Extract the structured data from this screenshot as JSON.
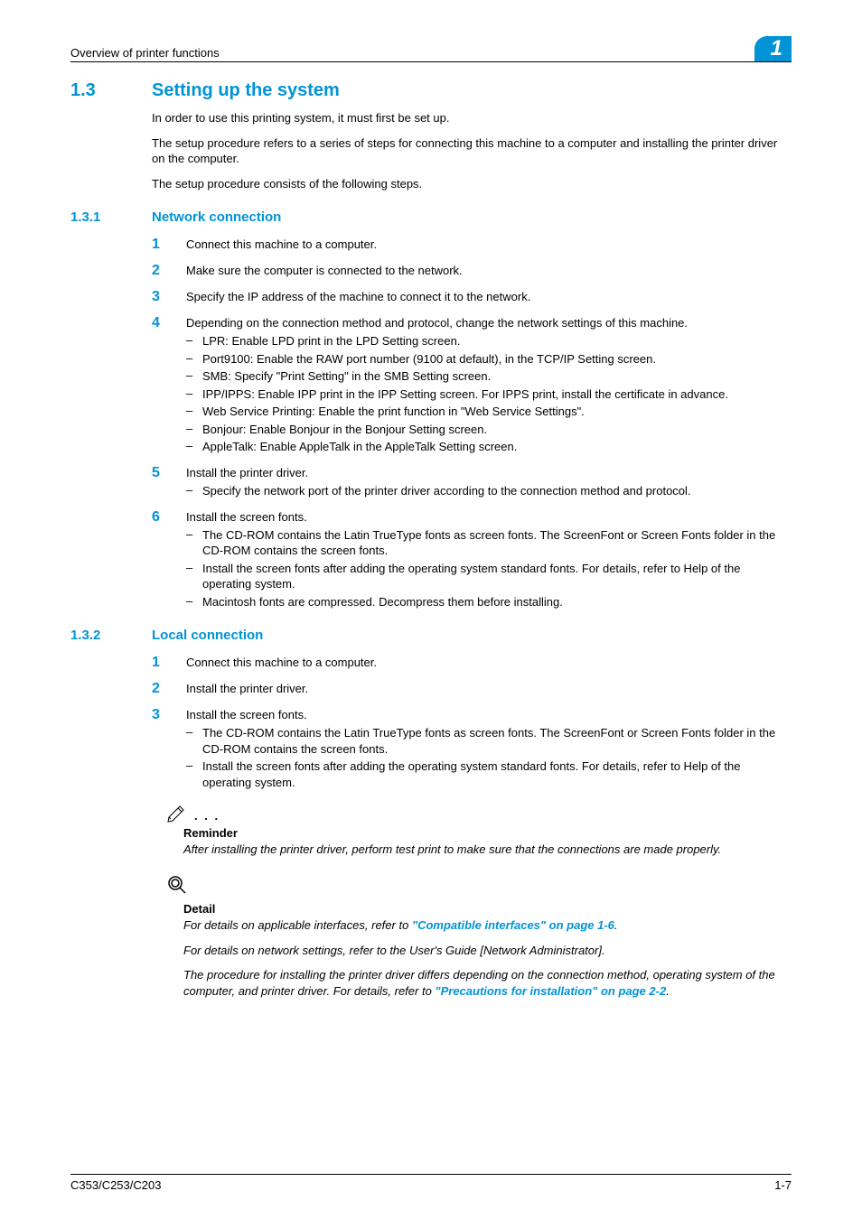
{
  "header": {
    "section_title": "Overview of printer functions",
    "chapter_number": "1"
  },
  "h1": {
    "num": "1.3",
    "title": "Setting up the system"
  },
  "intro": {
    "p1": "In order to use this printing system, it must first be set up.",
    "p2": "The setup procedure refers to a series of steps for connecting this machine to a computer and installing the printer driver on the computer.",
    "p3": "The setup procedure consists of the following steps."
  },
  "sec131": {
    "num": "1.3.1",
    "title": "Network connection",
    "steps": {
      "s1": {
        "n": "1",
        "t": "Connect this machine to a computer."
      },
      "s2": {
        "n": "2",
        "t": "Make sure the computer is connected to the network."
      },
      "s3": {
        "n": "3",
        "t": "Specify the IP address of the machine to connect it to the network."
      },
      "s4": {
        "n": "4",
        "t": "Depending on the connection method and protocol, change the network settings of this machine.",
        "sub": {
          "a": "LPR: Enable LPD print in the LPD Setting screen.",
          "b": "Port9100: Enable the RAW port number (9100 at default), in the TCP/IP Setting screen.",
          "c": "SMB: Specify \"Print Setting\" in the SMB Setting screen.",
          "d": "IPP/IPPS: Enable IPP print in the IPP Setting screen. For IPPS print, install the certificate in advance.",
          "e": "Web Service Printing: Enable the print function in \"Web Service Settings\".",
          "f": "Bonjour: Enable Bonjour in the Bonjour Setting screen.",
          "g": "AppleTalk: Enable AppleTalk in the AppleTalk Setting screen."
        }
      },
      "s5": {
        "n": "5",
        "t": "Install the printer driver.",
        "sub": {
          "a": "Specify the network port of the printer driver according to the connection method and protocol."
        }
      },
      "s6": {
        "n": "6",
        "t": "Install the screen fonts.",
        "sub": {
          "a": "The CD-ROM contains the Latin TrueType fonts as screen fonts. The ScreenFont or Screen Fonts folder in the CD-ROM contains the screen fonts.",
          "b": "Install the screen fonts after adding the operating system standard fonts. For details, refer to Help of the operating system.",
          "c": "Macintosh fonts are compressed. Decompress them before installing."
        }
      }
    }
  },
  "sec132": {
    "num": "1.3.2",
    "title": "Local connection",
    "steps": {
      "s1": {
        "n": "1",
        "t": "Connect this machine to a computer."
      },
      "s2": {
        "n": "2",
        "t": "Install the printer driver."
      },
      "s3": {
        "n": "3",
        "t": "Install the screen fonts.",
        "sub": {
          "a": "The CD-ROM contains the Latin TrueType fonts as screen fonts. The ScreenFont or Screen Fonts folder in the CD-ROM contains the screen fonts.",
          "b": "Install the screen fonts after adding the operating system standard fonts. For details, refer to Help of the operating system."
        }
      }
    }
  },
  "reminder": {
    "label": "Reminder",
    "body": "After installing the printer driver, perform test print to make sure that the connections are made properly."
  },
  "detail": {
    "label": "Detail",
    "p1_pre": "For details on applicable interfaces, refer to ",
    "p1_link": "\"Compatible interfaces\" on page 1-6",
    "p1_post": ".",
    "p2": "For details on network settings, refer to the User's Guide [Network Administrator].",
    "p3_pre": "The procedure for installing the printer driver differs depending on the connection method, operating system of the computer, and printer driver. For details, refer to ",
    "p3_link": "\"Precautions for installation\" on page 2-2",
    "p3_post": "."
  },
  "footer": {
    "model": "C353/C253/C203",
    "page": "1-7"
  },
  "glyphs": {
    "dash": "–",
    "dots": ". . ."
  }
}
